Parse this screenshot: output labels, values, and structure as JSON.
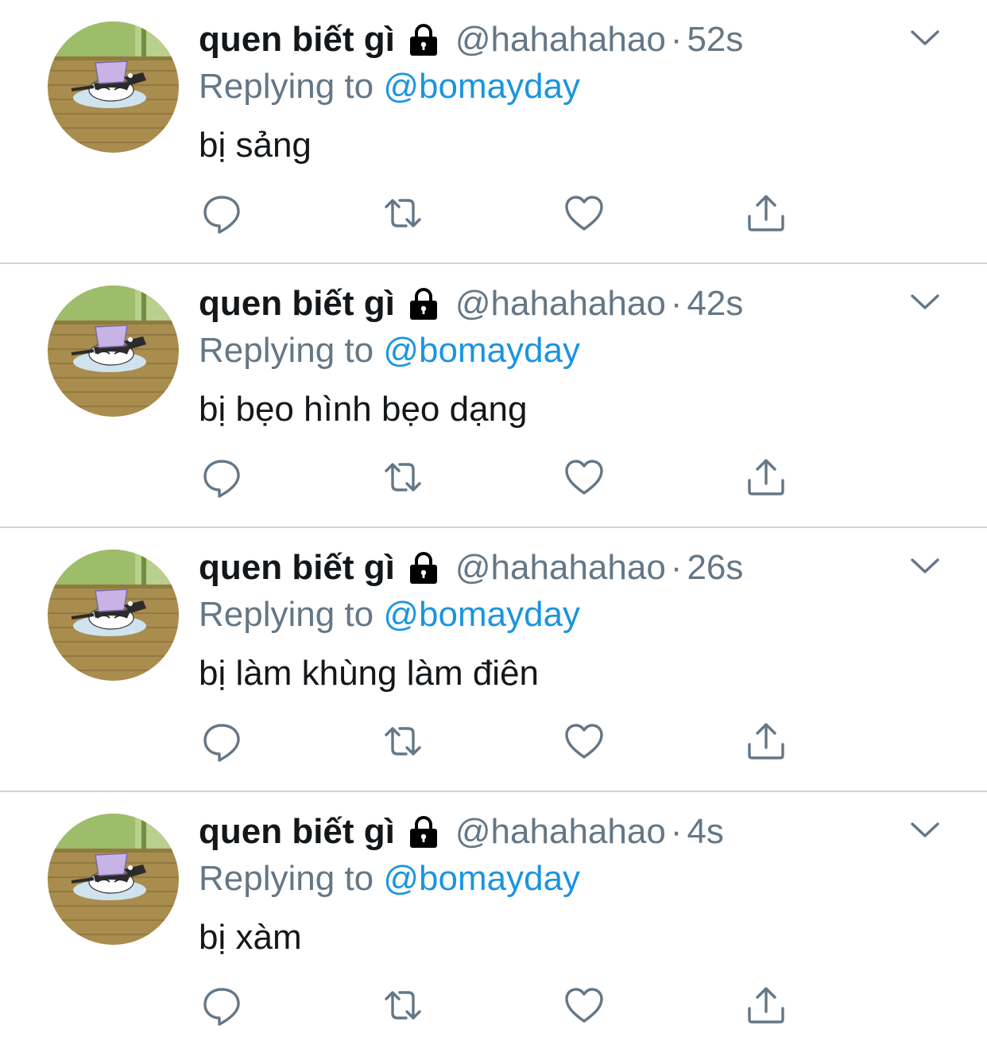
{
  "colors": {
    "text_primary": "#14171a",
    "text_secondary": "#657786",
    "link": "#1b95e0",
    "divider": "#cfd4d9"
  },
  "icons": {
    "lock": "lock-icon",
    "caret": "chevron-down-icon",
    "reply": "reply-icon",
    "retweet": "retweet-icon",
    "like": "heart-icon",
    "share": "share-icon"
  },
  "tweets": [
    {
      "display_name": "quen biết gì",
      "handle": "@hahahahao",
      "separator": "·",
      "time": "52s",
      "reply_prefix": "Replying to",
      "reply_to": "@bomayday",
      "text": "bị sảng"
    },
    {
      "display_name": "quen biết gì",
      "handle": "@hahahahao",
      "separator": "·",
      "time": "42s",
      "reply_prefix": "Replying to",
      "reply_to": "@bomayday",
      "text": "bị bẹo hình bẹo dạng"
    },
    {
      "display_name": "quen biết gì",
      "handle": "@hahahahao",
      "separator": "·",
      "time": "26s",
      "reply_prefix": "Replying to",
      "reply_to": "@bomayday",
      "text": "bị làm khùng làm điên"
    },
    {
      "display_name": "quen biết gì",
      "handle": "@hahahahao",
      "separator": "·",
      "time": "4s",
      "reply_prefix": "Replying to",
      "reply_to": "@bomayday",
      "text": "bị xàm"
    }
  ]
}
